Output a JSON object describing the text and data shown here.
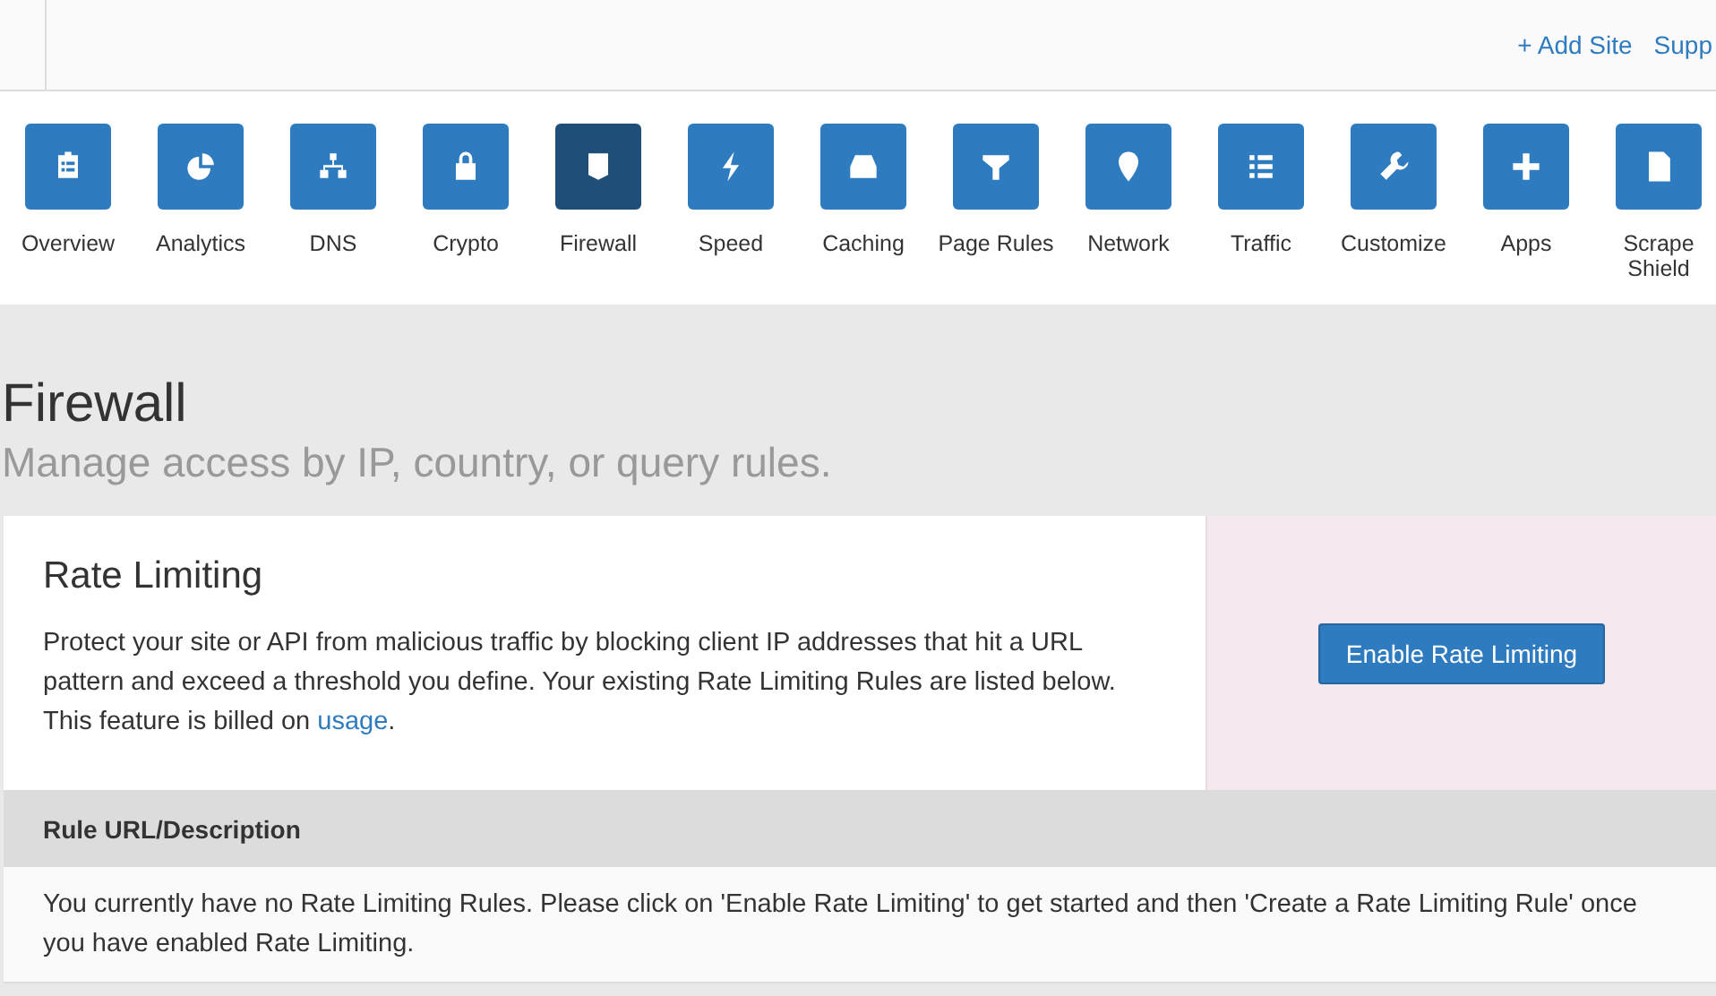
{
  "top_links": [
    "+ Add Site",
    "Supp"
  ],
  "nav": [
    {
      "label": "Overview",
      "selected": false
    },
    {
      "label": "Analytics",
      "selected": false
    },
    {
      "label": "DNS",
      "selected": false
    },
    {
      "label": "Crypto",
      "selected": false
    },
    {
      "label": "Firewall",
      "selected": true
    },
    {
      "label": "Speed",
      "selected": false
    },
    {
      "label": "Caching",
      "selected": false
    },
    {
      "label": "Page Rules",
      "selected": false
    },
    {
      "label": "Network",
      "selected": false
    },
    {
      "label": "Traffic",
      "selected": false
    },
    {
      "label": "Customize",
      "selected": false
    },
    {
      "label": "Apps",
      "selected": false
    },
    {
      "label": "Scrape Shield",
      "selected": false
    }
  ],
  "page": {
    "title": "Firewall",
    "subtitle": "Manage access by IP, country, or query rules."
  },
  "card": {
    "title": "Rate Limiting",
    "description": "Protect your site or API from malicious traffic by blocking client IP addresses that hit a URL pattern and exceed a threshold you define. Your existing Rate Limiting Rules are listed below. This feature is billed on ",
    "link": "usage",
    "after": ".",
    "button": "Enable Rate Limiting"
  },
  "table": {
    "columns": [
      "Rule URL/Description"
    ],
    "empty_message": "You currently have no Rate Limiting Rules. Please click on 'Enable Rate Limiting' to get started and then 'Create a Rate Limiting Rule' once you have enabled Rate Limiting."
  }
}
